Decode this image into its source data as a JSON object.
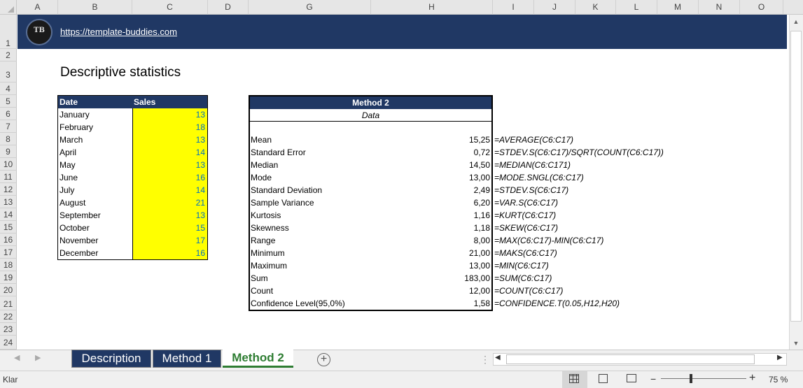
{
  "columns": [
    "A",
    "B",
    "C",
    "D",
    "G",
    "H",
    "I",
    "J",
    "K",
    "L",
    "M",
    "N",
    "O"
  ],
  "rows": [
    "1",
    "2",
    "3",
    "4",
    "5",
    "6",
    "7",
    "8",
    "9",
    "10",
    "11",
    "12",
    "13",
    "14",
    "15",
    "16",
    "17",
    "18",
    "19",
    "20",
    "21",
    "22",
    "23",
    "24"
  ],
  "banner": {
    "logo_text": "TB",
    "url": "https://template-buddies.com"
  },
  "title": "Descriptive statistics",
  "sales_table": {
    "headers": [
      "Date",
      "Sales"
    ],
    "rows": [
      {
        "month": "January",
        "sales": "13"
      },
      {
        "month": "February",
        "sales": "18"
      },
      {
        "month": "March",
        "sales": "13"
      },
      {
        "month": "April",
        "sales": "14"
      },
      {
        "month": "May",
        "sales": "13"
      },
      {
        "month": "June",
        "sales": "16"
      },
      {
        "month": "July",
        "sales": "14"
      },
      {
        "month": "August",
        "sales": "21"
      },
      {
        "month": "September",
        "sales": "13"
      },
      {
        "month": "October",
        "sales": "15"
      },
      {
        "month": "November",
        "sales": "17"
      },
      {
        "month": "December",
        "sales": "16"
      }
    ]
  },
  "stats_table": {
    "header": "Method 2",
    "subheader": "Data",
    "rows": [
      {
        "label": "Mean",
        "value": "15,25",
        "formula": "=AVERAGE(C6:C17)"
      },
      {
        "label": "Standard Error",
        "value": "0,72",
        "formula": "=STDEV.S(C6:C17)/SQRT(COUNT(C6:C17))"
      },
      {
        "label": "Median",
        "value": "14,50",
        "formula": "=MEDIAN(C6:C171)"
      },
      {
        "label": "Mode",
        "value": "13,00",
        "formula": "=MODE.SNGL(C6:C17)"
      },
      {
        "label": "Standard Deviation",
        "value": "2,49",
        "formula": "=STDEV.S(C6:C17)"
      },
      {
        "label": "Sample Variance",
        "value": "6,20",
        "formula": "=VAR.S(C6:C17)"
      },
      {
        "label": "Kurtosis",
        "value": "1,16",
        "formula": "=KURT(C6:C17)"
      },
      {
        "label": "Skewness",
        "value": "1,18",
        "formula": "=SKEW(C6:C17)"
      },
      {
        "label": "Range",
        "value": "8,00",
        "formula": "=MAX(C6:C17)-MIN(C6:C17)"
      },
      {
        "label": "Minimum",
        "value": "21,00",
        "formula": "=MAKS(C6:C17)"
      },
      {
        "label": "Maximum",
        "value": "13,00",
        "formula": "=MIN(C6:C17)"
      },
      {
        "label": "Sum",
        "value": "183,00",
        "formula": "=SUM(C6:C17)"
      },
      {
        "label": "Count",
        "value": "12,00",
        "formula": "=COUNT(C6:C17)"
      },
      {
        "label": "Confidence Level(95,0%)",
        "value": "1,58",
        "formula": "=CONFIDENCE.T(0.05,H12,H20)"
      }
    ]
  },
  "sheet_tabs": [
    {
      "label": "Description",
      "active": false
    },
    {
      "label": "Method 1",
      "active": false
    },
    {
      "label": "Method 2",
      "active": true
    }
  ],
  "status": {
    "text": "Klar",
    "zoom": "75 %"
  },
  "colors": {
    "navy": "#203864",
    "highlight": "#ffff00",
    "number_blue": "#0070c0",
    "active_tab_green": "#2e7d32"
  }
}
